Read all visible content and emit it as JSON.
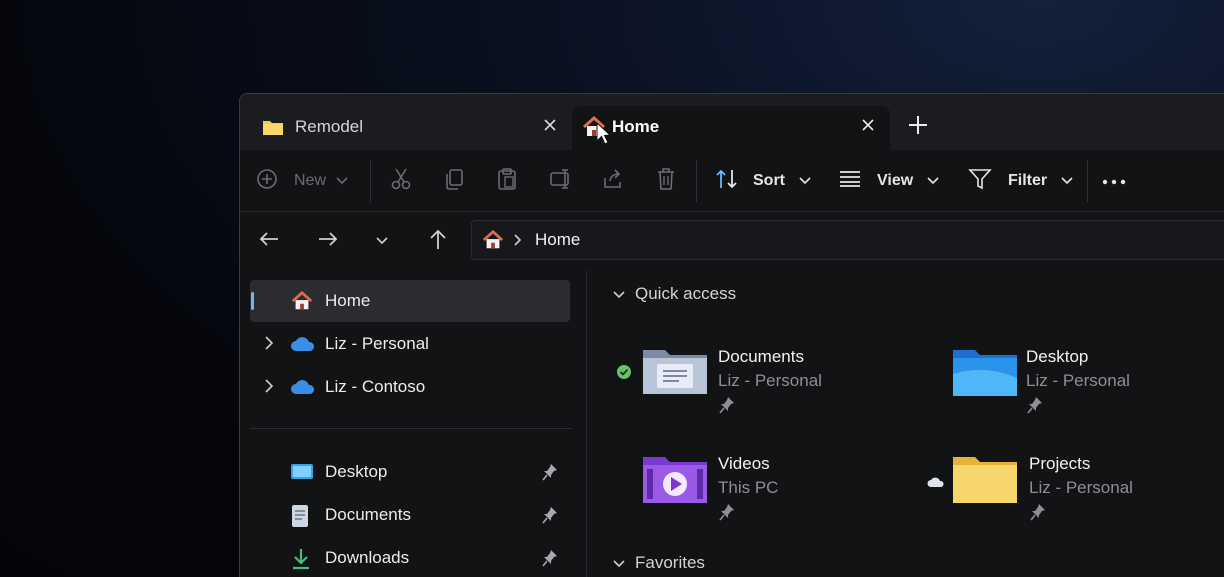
{
  "tabs": [
    {
      "label": "Remodel",
      "icon": "folder-icon",
      "active": false
    },
    {
      "label": "Home",
      "icon": "home-icon",
      "active": true
    }
  ],
  "toolbar": {
    "new_label": "New",
    "sort_label": "Sort",
    "view_label": "View",
    "filter_label": "Filter"
  },
  "address": {
    "path": "Home"
  },
  "sidebar": {
    "items": [
      {
        "label": "Home",
        "icon": "home-icon",
        "selected": true
      },
      {
        "label": "Liz - Personal",
        "icon": "onedrive-cloud-icon"
      },
      {
        "label": "Liz - Contoso",
        "icon": "onedrive-cloud-icon"
      }
    ],
    "pinned": [
      {
        "label": "Desktop",
        "icon": "desktop-icon"
      },
      {
        "label": "Documents",
        "icon": "documents-icon"
      },
      {
        "label": "Downloads",
        "icon": "download-arrow-icon"
      }
    ]
  },
  "main": {
    "quick_access_header": "Quick access",
    "favorites_header": "Favorites",
    "quick_access": [
      {
        "name": "Documents",
        "location": "Liz - Personal",
        "status": "synced"
      },
      {
        "name": "Desktop",
        "location": "Liz - Personal"
      },
      {
        "name": "Videos",
        "location": "This PC"
      },
      {
        "name": "Projects",
        "location": "Liz - Personal",
        "status": "cloud"
      }
    ]
  },
  "colors": {
    "accent": "#6cb8f6",
    "home_icon": "#e06c4a",
    "folder_yellow": "#f4c84a",
    "synced_green": "#6bbf6b"
  }
}
